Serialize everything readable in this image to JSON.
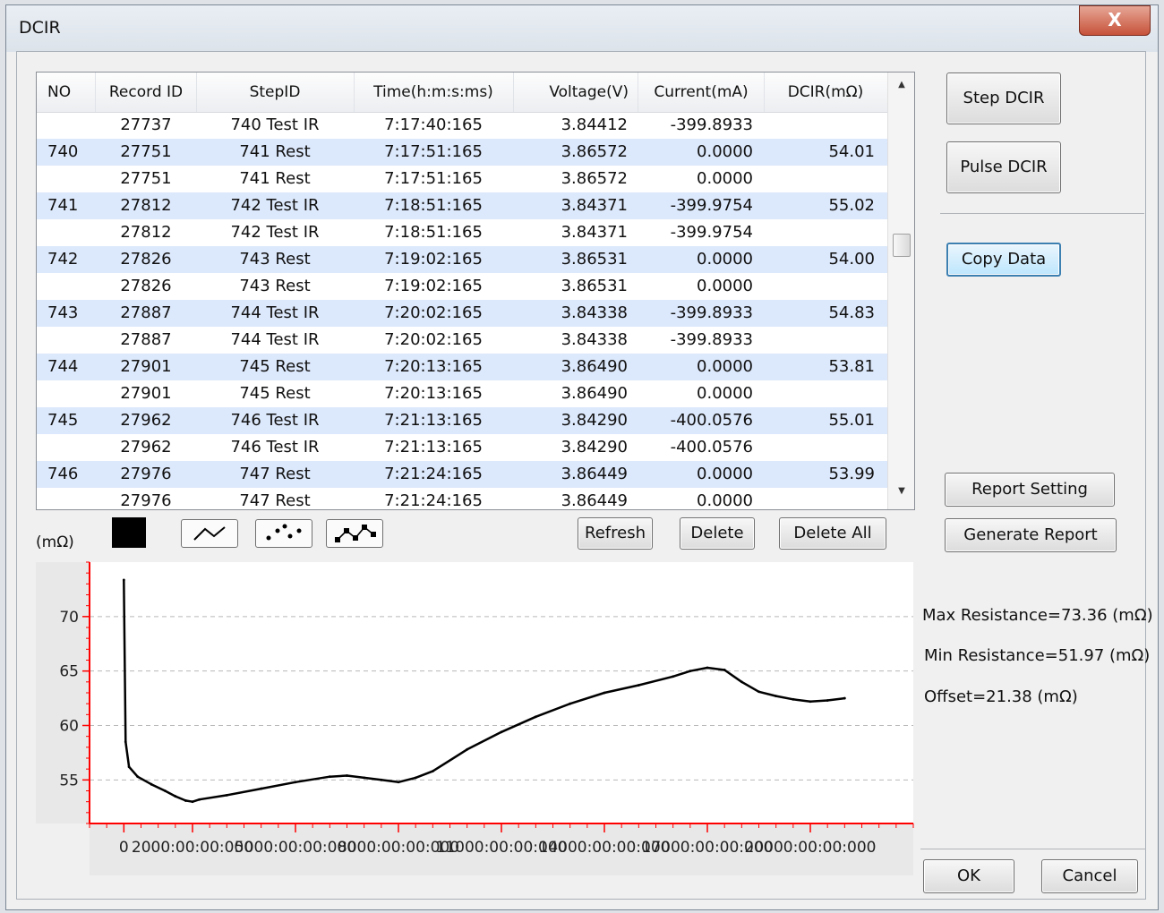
{
  "window": {
    "title": "DCIR",
    "close_label": "X"
  },
  "table": {
    "columns": [
      "NO",
      "Record ID",
      "StepID",
      "Time(h:m:s:ms)",
      "Voltage(V)",
      "Current(mA)",
      "DCIR(mΩ)"
    ],
    "rows": [
      [
        "",
        "27737",
        "740 Test IR",
        "7:17:40:165",
        "3.84412",
        "-399.8933",
        ""
      ],
      [
        "740",
        "27751",
        "741 Rest",
        "7:17:51:165",
        "3.86572",
        "0.0000",
        "54.01"
      ],
      [
        "",
        "27751",
        "741 Rest",
        "7:17:51:165",
        "3.86572",
        "0.0000",
        ""
      ],
      [
        "741",
        "27812",
        "742 Test IR",
        "7:18:51:165",
        "3.84371",
        "-399.9754",
        "55.02"
      ],
      [
        "",
        "27812",
        "742 Test IR",
        "7:18:51:165",
        "3.84371",
        "-399.9754",
        ""
      ],
      [
        "742",
        "27826",
        "743 Rest",
        "7:19:02:165",
        "3.86531",
        "0.0000",
        "54.00"
      ],
      [
        "",
        "27826",
        "743 Rest",
        "7:19:02:165",
        "3.86531",
        "0.0000",
        ""
      ],
      [
        "743",
        "27887",
        "744 Test IR",
        "7:20:02:165",
        "3.84338",
        "-399.8933",
        "54.83"
      ],
      [
        "",
        "27887",
        "744 Test IR",
        "7:20:02:165",
        "3.84338",
        "-399.8933",
        ""
      ],
      [
        "744",
        "27901",
        "745 Rest",
        "7:20:13:165",
        "3.86490",
        "0.0000",
        "53.81"
      ],
      [
        "",
        "27901",
        "745 Rest",
        "7:20:13:165",
        "3.86490",
        "0.0000",
        ""
      ],
      [
        "745",
        "27962",
        "746 Test IR",
        "7:21:13:165",
        "3.84290",
        "-400.0576",
        "55.01"
      ],
      [
        "",
        "27962",
        "746 Test IR",
        "7:21:13:165",
        "3.84290",
        "-400.0576",
        ""
      ],
      [
        "746",
        "27976",
        "747 Rest",
        "7:21:24:165",
        "3.86449",
        "0.0000",
        "53.99"
      ],
      [
        "",
        "27976",
        "747 Rest",
        "7:21:24:165",
        "3.86449",
        "0.0000",
        ""
      ]
    ]
  },
  "buttons": {
    "step_dcir": "Step DCIR",
    "pulse_dcir": "Pulse DCIR",
    "copy_data": "Copy Data",
    "report_setting": "Report Setting",
    "generate_report": "Generate Report",
    "refresh": "Refresh",
    "delete": "Delete",
    "delete_all": "Delete All",
    "ok": "OK",
    "cancel": "Cancel"
  },
  "plot_controls": {
    "color_swatch": "#000000",
    "modes": [
      "line-mode-icon",
      "scatter-mode-icon",
      "line-scatter-mode-icon"
    ]
  },
  "stats": {
    "max": "Max Resistance=73.36 (mΩ)",
    "min": "Min Resistance=51.97 (mΩ)",
    "offset": "Offset=21.38 (mΩ)"
  },
  "chart_data": {
    "type": "line",
    "ylabel": "(mΩ)",
    "ylim": [
      51,
      75
    ],
    "yticks": [
      55,
      60,
      65,
      70
    ],
    "xlim": [
      -1000,
      23000
    ],
    "xtick_values": [
      0,
      2000,
      5000,
      8000,
      11000,
      14000,
      17000,
      20000
    ],
    "xtick_labels": [
      "0",
      "2000:00:00:000",
      "5000:00:00:000",
      "8000:00:00:000",
      "11000:00:00:000",
      "14000:00:00:000",
      "17000:00:00:000",
      "20000:00:00:000"
    ],
    "series": [
      {
        "color": "#000000",
        "x": [
          0,
          50,
          150,
          400,
          800,
          1200,
          1500,
          1800,
          2000,
          2200,
          3000,
          4000,
          5000,
          6000,
          6500,
          7000,
          7500,
          8000,
          8500,
          9000,
          10000,
          11000,
          12000,
          13000,
          14000,
          15000,
          16000,
          16500,
          17000,
          17500,
          18000,
          18500,
          19000,
          19500,
          20000,
          20500,
          21000
        ],
        "y": [
          73.36,
          58.5,
          56.2,
          55.3,
          54.6,
          54.0,
          53.5,
          53.1,
          53.0,
          53.2,
          53.6,
          54.2,
          54.8,
          55.3,
          55.4,
          55.2,
          55.0,
          54.8,
          55.2,
          55.8,
          57.8,
          59.4,
          60.8,
          62.0,
          63.0,
          63.7,
          64.5,
          65.0,
          65.3,
          65.1,
          64.0,
          63.1,
          62.7,
          62.4,
          62.2,
          62.3,
          62.5
        ]
      }
    ]
  }
}
